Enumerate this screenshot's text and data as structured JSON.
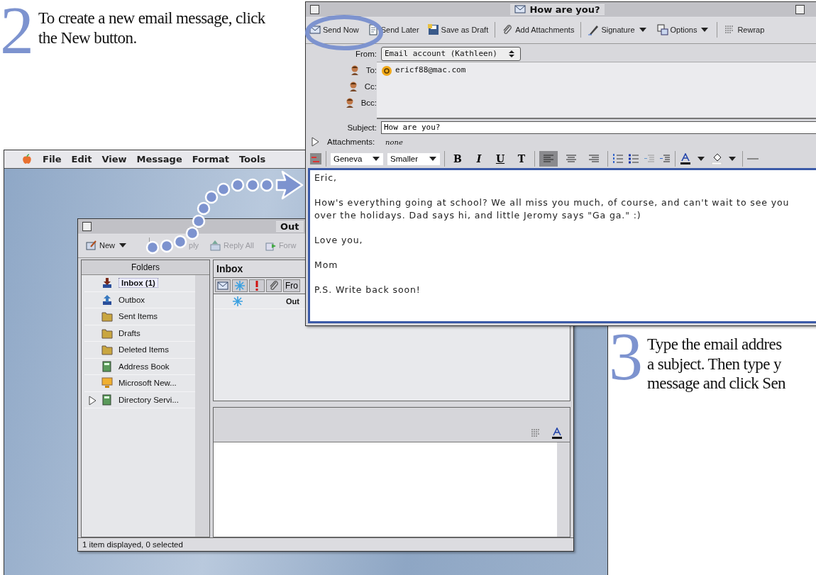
{
  "steps": [
    {
      "number": "2",
      "lines": [
        "To create a new email message, click",
        "the New button."
      ]
    },
    {
      "number": "3",
      "lines": [
        "Type the email addres",
        "a subject. Then type y",
        "message and click Sen"
      ]
    }
  ],
  "menu_bar": {
    "items": [
      "File",
      "Edit",
      "View",
      "Message",
      "Format",
      "Tools"
    ]
  },
  "main_window": {
    "title": "Out",
    "toolbar": [
      {
        "label": "New",
        "dropdown": true
      },
      {
        "label": "ply",
        "dropdown": false
      },
      {
        "label": "Reply All",
        "dropdown": false
      },
      {
        "label": "Forw",
        "dropdown": false
      }
    ],
    "folders_header": "Folders",
    "folders": [
      {
        "label": "Inbox (1)",
        "selected": true
      },
      {
        "label": "Outbox",
        "selected": false
      },
      {
        "label": "Sent Items",
        "selected": false
      },
      {
        "label": "Drafts",
        "selected": false
      },
      {
        "label": "Deleted Items",
        "selected": false
      },
      {
        "label": "Address Book",
        "selected": false
      },
      {
        "label": "Microsoft New...",
        "selected": false
      },
      {
        "label": "Directory Servi...",
        "selected": false,
        "expanded": false
      }
    ],
    "list_title": "Inbox",
    "columns": [
      {
        "kind": "envelope"
      },
      {
        "kind": "asterisk"
      },
      {
        "kind": "exclamation"
      },
      {
        "kind": "paperclip"
      },
      {
        "kind": "text",
        "label": "Fro"
      }
    ],
    "rows": [
      {
        "from": "Out",
        "unread": true
      }
    ],
    "status": "1 item displayed, 0 selected"
  },
  "compose_window": {
    "title": "How are you?",
    "toolbar": [
      {
        "label": "Send Now",
        "dropdown": false
      },
      {
        "label": "Send Later",
        "dropdown": false
      },
      {
        "label": "Save as Draft",
        "dropdown": false
      },
      {
        "label": "Add Attachments",
        "dropdown": false
      },
      {
        "label": "Signature",
        "dropdown": true
      },
      {
        "label": "Options",
        "dropdown": true
      },
      {
        "label": "Rewrap",
        "dropdown": false
      }
    ],
    "from_label": "From:",
    "from_value": "Email account (Kathleen)",
    "to_label": "To:",
    "to": [
      "ericf88@mac.com"
    ],
    "cc_label": "Cc:",
    "bcc_label": "Bcc:",
    "subject_label": "Subject:",
    "subject": "How are you?",
    "attachments_label": "Attachments:",
    "attachments": "none",
    "font": "Geneva",
    "size": "Smaller",
    "styles": [
      "B",
      "I",
      "U",
      "T"
    ],
    "align": [
      {
        "kind": "left",
        "selected": true
      },
      {
        "kind": "center",
        "selected": false
      },
      {
        "kind": "right",
        "selected": false
      }
    ],
    "body": [
      "Eric,",
      "How's everything going at school? We all miss you much, of course, and can't wait to see you over the holidays. Dad says hi, and little Jeromy says \"Ga ga.\" :)",
      "Love you,",
      "Mom",
      "P.S. Write back soon!"
    ]
  }
}
